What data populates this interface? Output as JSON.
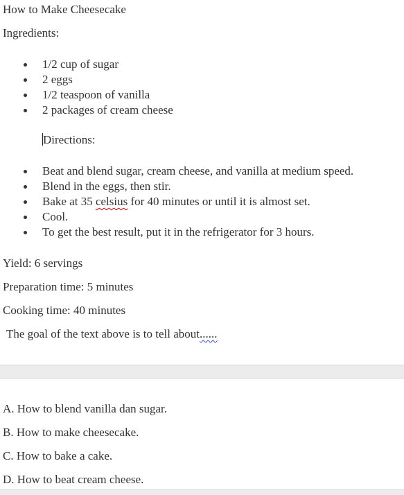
{
  "title": "How to Make Cheesecake",
  "ingredients_heading": "Ingredients:",
  "ingredients": [
    "1/2 cup of sugar",
    "2 eggs",
    "1/2 teaspoon of vanilla",
    "2 packages of cream cheese"
  ],
  "directions_heading": "Directions:",
  "directions": {
    "d0": "Beat and blend sugar, cream cheese, and vanilla at medium speed.",
    "d1": "Blend in the eggs, then stir.",
    "d2_before": "Bake at 35 ",
    "d2_misspelled": "celsius",
    "d2_after": " for 40 minutes or until it is almost set.",
    "d3": "Cool.",
    "d4": "To get the best result, put it in the refrigerator for 3 hours."
  },
  "yield": "Yield: 6 servings",
  "prep_time": "Preparation time: 5 minutes",
  "cook_time": "Cooking time: 40 minutes",
  "question_prefix": "The goal of the text above is to tell about",
  "question_blank": "......",
  "options": [
    "A. How to blend vanilla dan sugar.",
    "B. How to make cheesecake.",
    "C. How to bake a cake.",
    "D. How to beat cream cheese."
  ],
  "colors": {
    "text": "#333333",
    "spell_error": "#d00000",
    "grammar_hint": "#2a4bd7",
    "separator": "#ececec"
  }
}
